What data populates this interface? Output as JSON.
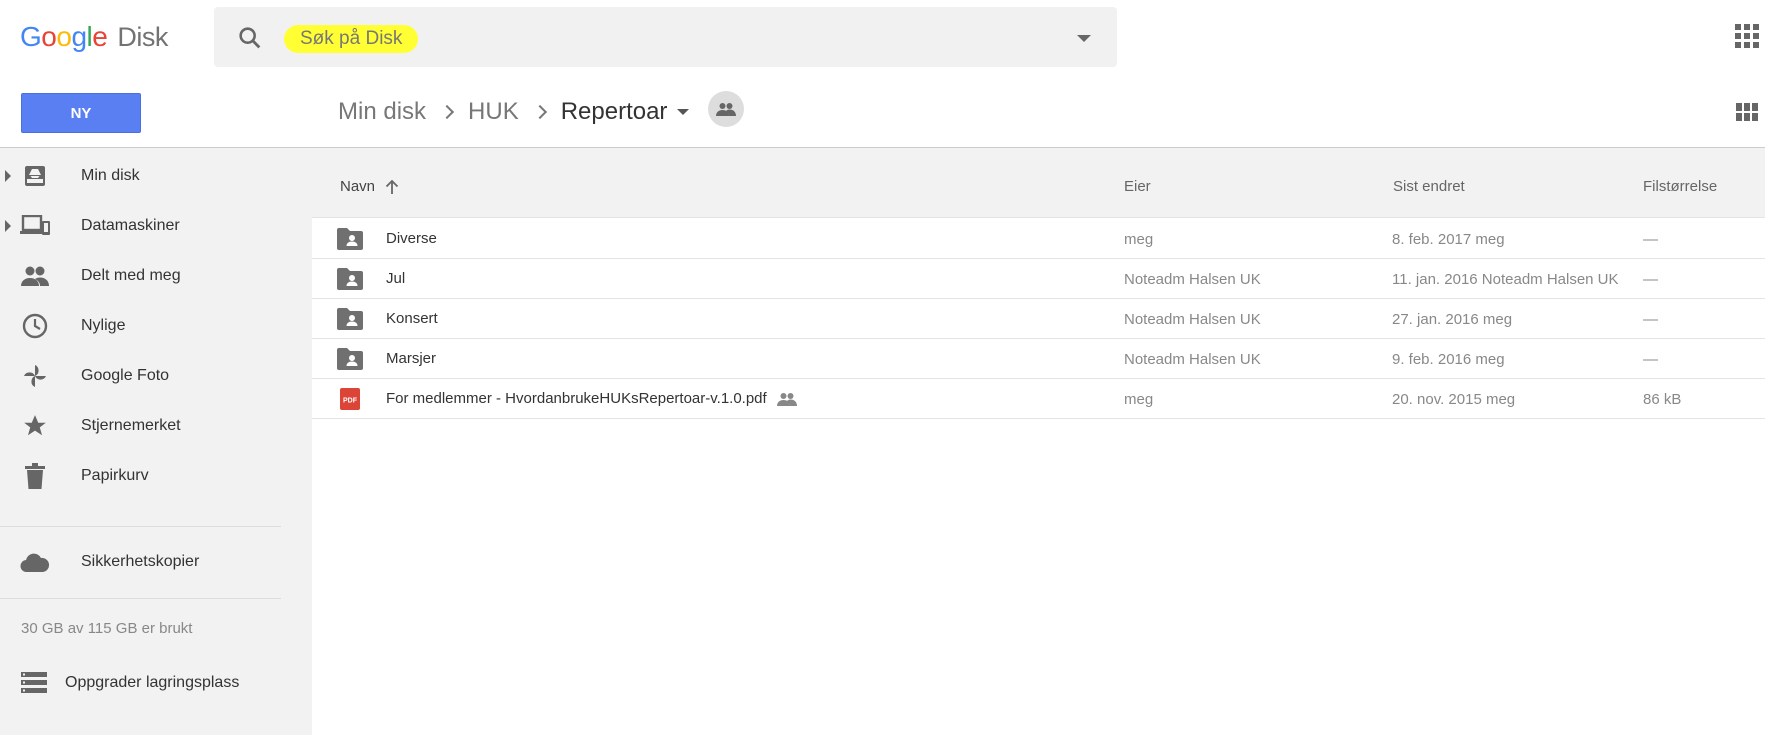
{
  "app": {
    "logo_letters": [
      "G",
      "o",
      "o",
      "g",
      "l",
      "e"
    ],
    "product": "Disk"
  },
  "search": {
    "placeholder": "Søk på Disk"
  },
  "toolbar": {
    "new_label": "NY"
  },
  "breadcrumb": {
    "items": [
      "Min disk",
      "HUK"
    ],
    "current": "Repertoar"
  },
  "sidebar": {
    "items": [
      {
        "label": "Min disk",
        "icon": "drive-icon",
        "expandable": true
      },
      {
        "label": "Datamaskiner",
        "icon": "computers-icon",
        "expandable": true
      },
      {
        "label": "Delt med meg",
        "icon": "people-icon",
        "expandable": false
      },
      {
        "label": "Nylige",
        "icon": "clock-icon",
        "expandable": false
      },
      {
        "label": "Google Foto",
        "icon": "photos-icon",
        "expandable": false
      },
      {
        "label": "Stjernemerket",
        "icon": "star-icon",
        "expandable": false
      },
      {
        "label": "Papirkurv",
        "icon": "trash-icon",
        "expandable": false
      }
    ],
    "backup": {
      "label": "Sikkerhetskopier",
      "icon": "cloud-icon"
    },
    "storage_text": "30 GB av 115 GB er brukt",
    "upgrade": {
      "label": "Oppgrader lagringsplass",
      "icon": "storage-icon"
    }
  },
  "table": {
    "headers": {
      "name": "Navn",
      "owner": "Eier",
      "modified": "Sist endret",
      "size": "Filstørrelse"
    },
    "rows": [
      {
        "type": "folder",
        "name": "Diverse",
        "owner": "meg",
        "modified": "8. feb. 2017  meg",
        "size": "—"
      },
      {
        "type": "folder",
        "name": "Jul",
        "owner": "Noteadm Halsen UK",
        "modified": "11. jan. 2016  Noteadm Halsen UK",
        "size": "—"
      },
      {
        "type": "folder",
        "name": "Konsert",
        "owner": "Noteadm Halsen UK",
        "modified": "27. jan. 2016  meg",
        "size": "—"
      },
      {
        "type": "folder",
        "name": "Marsjer",
        "owner": "Noteadm Halsen UK",
        "modified": "9. feb. 2016  meg",
        "size": "—"
      },
      {
        "type": "pdf",
        "name": "For medlemmer - HvordanbrukeHUKsRepertoar-v.1.0.pdf",
        "owner": "meg",
        "modified": "20. nov. 2015  meg",
        "size": "86 kB",
        "shared": true
      }
    ]
  },
  "colors": {
    "accent": "#5a7ff2",
    "highlight": "#ffff33",
    "pdf_red": "#db4437"
  }
}
